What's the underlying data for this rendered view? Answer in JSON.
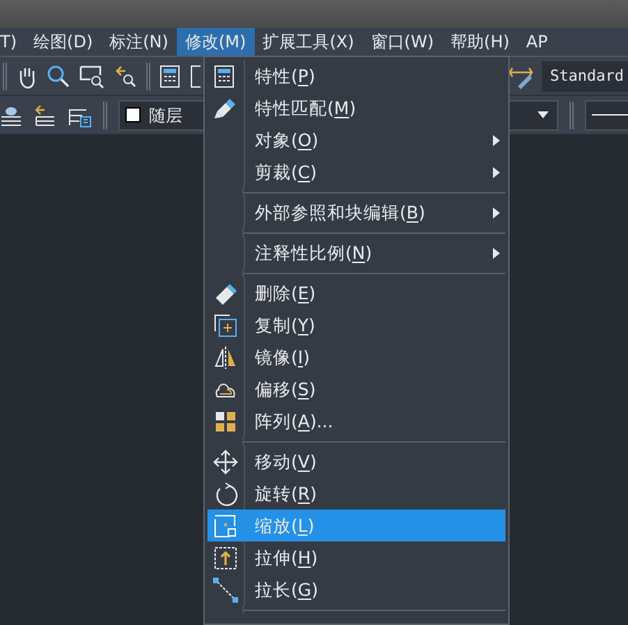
{
  "menubar": [
    {
      "label": "T)",
      "selected": false
    },
    {
      "label": "绘图(D)",
      "selected": false
    },
    {
      "label": "标注(N)",
      "selected": false
    },
    {
      "label": "修改(M)",
      "selected": true
    },
    {
      "label": "扩展工具(X)",
      "selected": false
    },
    {
      "label": "窗口(W)",
      "selected": false
    },
    {
      "label": "帮助(H)",
      "selected": false
    },
    {
      "label": "AP",
      "selected": false
    }
  ],
  "toolbar": {
    "dimstyle": "Standard",
    "layer": "随层"
  },
  "menu": [
    {
      "kind": "item",
      "before": "特性(",
      "mnemonic": "P",
      "after": ")",
      "submenu": false,
      "selected": false
    },
    {
      "kind": "item",
      "before": "特性匹配(",
      "mnemonic": "M",
      "after": ")",
      "submenu": false,
      "selected": false
    },
    {
      "kind": "item",
      "before": "对象(",
      "mnemonic": "O",
      "after": ")",
      "submenu": true,
      "selected": false
    },
    {
      "kind": "item",
      "before": "剪裁(",
      "mnemonic": "C",
      "after": ")",
      "submenu": true,
      "selected": false
    },
    {
      "kind": "separator"
    },
    {
      "kind": "item",
      "before": "外部参照和块编辑(",
      "mnemonic": "B",
      "after": ")",
      "submenu": true,
      "selected": false
    },
    {
      "kind": "separator"
    },
    {
      "kind": "item",
      "before": "注释性比例(",
      "mnemonic": "N",
      "after": ")",
      "submenu": true,
      "selected": false
    },
    {
      "kind": "separator"
    },
    {
      "kind": "item",
      "before": "删除(",
      "mnemonic": "E",
      "after": ")",
      "submenu": false,
      "selected": false
    },
    {
      "kind": "item",
      "before": "复制(",
      "mnemonic": "Y",
      "after": ")",
      "submenu": false,
      "selected": false
    },
    {
      "kind": "item",
      "before": "镜像(",
      "mnemonic": "I",
      "after": ")",
      "submenu": false,
      "selected": false
    },
    {
      "kind": "item",
      "before": "偏移(",
      "mnemonic": "S",
      "after": ")",
      "submenu": false,
      "selected": false
    },
    {
      "kind": "item",
      "before": "阵列(",
      "mnemonic": "A",
      "after": ")...",
      "submenu": false,
      "selected": false
    },
    {
      "kind": "separator"
    },
    {
      "kind": "item",
      "before": "移动(",
      "mnemonic": "V",
      "after": ")",
      "submenu": false,
      "selected": false
    },
    {
      "kind": "item",
      "before": "旋转(",
      "mnemonic": "R",
      "after": ")",
      "submenu": false,
      "selected": false
    },
    {
      "kind": "item",
      "before": "缩放(",
      "mnemonic": "L",
      "after": ")",
      "submenu": false,
      "selected": true
    },
    {
      "kind": "item",
      "before": "拉伸(",
      "mnemonic": "H",
      "after": ")",
      "submenu": false,
      "selected": false
    },
    {
      "kind": "item",
      "before": "拉长(",
      "mnemonic": "G",
      "after": ")",
      "submenu": false,
      "selected": false
    },
    {
      "kind": "separator"
    }
  ]
}
